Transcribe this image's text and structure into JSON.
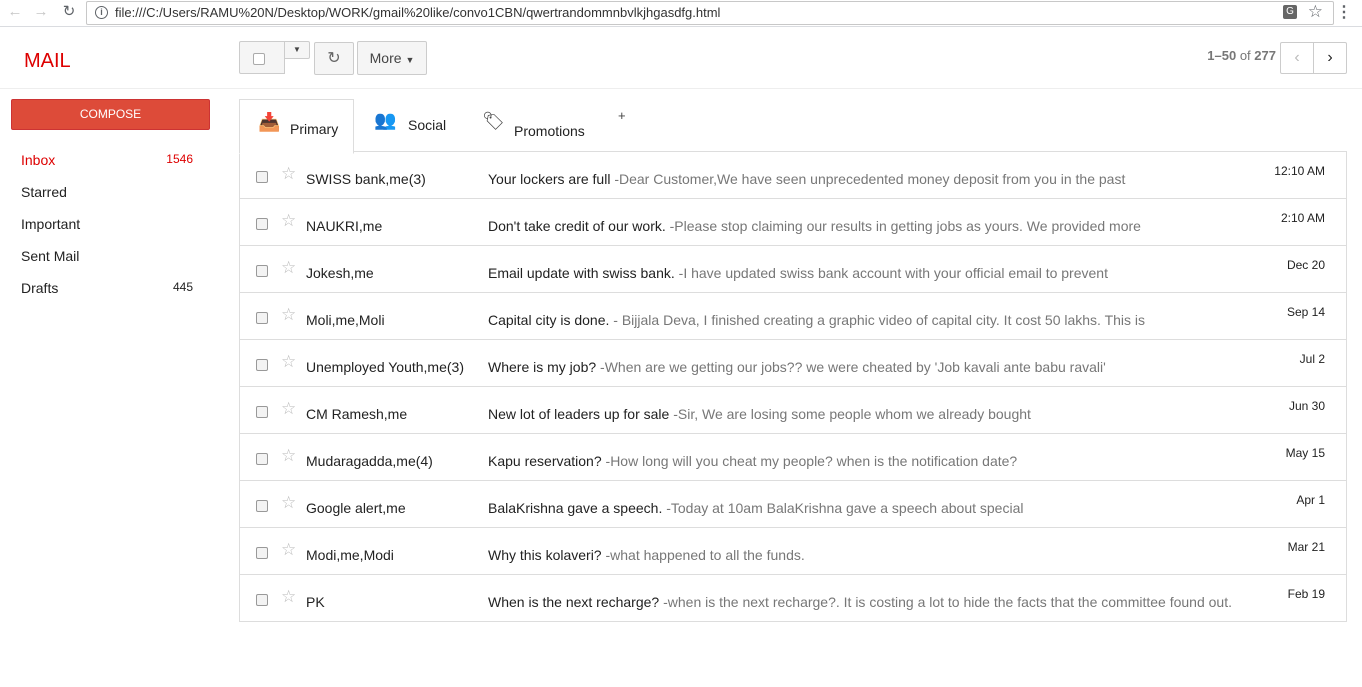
{
  "browser": {
    "back_icon": "arrow-left-icon",
    "forward_icon": "arrow-right-icon",
    "reload_icon": "reload-icon",
    "url": "file:///C:/Users/RAMU%20N/Desktop/WORK/gmail%20like/convo1CBN/qwertrandommnbvlkjhgasdfg.html"
  },
  "app": {
    "logo": "MAIL"
  },
  "toolbar": {
    "more_label": "More",
    "pager_range": "1–50",
    "pager_of": "of",
    "pager_total": "277"
  },
  "sidebar": {
    "compose_label": "COMPOSE",
    "items": [
      {
        "label": "Inbox",
        "count": "1546",
        "active": true
      },
      {
        "label": "Starred",
        "count": ""
      },
      {
        "label": "Important",
        "count": ""
      },
      {
        "label": "Sent Mail",
        "count": ""
      },
      {
        "label": "Drafts",
        "count": "445"
      }
    ]
  },
  "tabs": [
    {
      "label": "Primary",
      "icon": "inbox-icon",
      "active": true
    },
    {
      "label": "Social",
      "icon": "people-icon"
    },
    {
      "label": "Promotions",
      "icon": "tag-icon"
    }
  ],
  "add_tab_label": "+",
  "emails": [
    {
      "sender": "SWISS bank,me(3)",
      "subject": "Your lockers are full",
      "snippet": "-Dear Customer,We have seen unprecedented money deposit from you in the past",
      "date": "12:10 AM"
    },
    {
      "sender": "NAUKRI,me",
      "subject": "Don't take credit of our work.",
      "snippet": "-Please stop claiming our results in getting jobs as yours. We provided more",
      "date": "2:10 AM"
    },
    {
      "sender": "Jokesh,me",
      "subject": "Email update with swiss bank.",
      "snippet": "-I have updated swiss bank account with your official email to prevent",
      "date": "Dec 20"
    },
    {
      "sender": "Moli,me,Moli",
      "subject": "Capital city is done.",
      "snippet": "- Bijjala Deva, I finished creating a graphic video of capital city. It cost 50 lakhs. This is",
      "date": "Sep 14"
    },
    {
      "sender": "Unemployed Youth,me(3)",
      "subject": "Where is my job?",
      "snippet": "-When are we getting our jobs?? we were cheated by 'Job kavali ante babu ravali'",
      "date": "Jul 2"
    },
    {
      "sender": "CM Ramesh,me",
      "subject": "New lot of leaders up for sale",
      "snippet": "-Sir, We are losing some people whom we already bought",
      "date": "Jun 30"
    },
    {
      "sender": "Mudaragadda,me(4)",
      "subject": "Kapu reservation?",
      "snippet": "-How long will you cheat my people? when is the notification date?",
      "date": "May 15"
    },
    {
      "sender": "Google alert,me",
      "subject": "BalaKrishna gave a speech.",
      "snippet": "-Today at 10am BalaKrishna gave a speech about special",
      "date": "Apr 1"
    },
    {
      "sender": "Modi,me,Modi",
      "subject": "Why this kolaveri?",
      "snippet": "-what happened to all the funds.",
      "date": "Mar 21"
    },
    {
      "sender": "PK",
      "subject": "When is the next recharge?",
      "snippet": "-when is the next recharge?. It is costing a lot to hide the facts that the committee found out.",
      "date": "Feb 19"
    }
  ],
  "colors": {
    "accent": "#dd0000",
    "compose": "#dd4b39"
  }
}
